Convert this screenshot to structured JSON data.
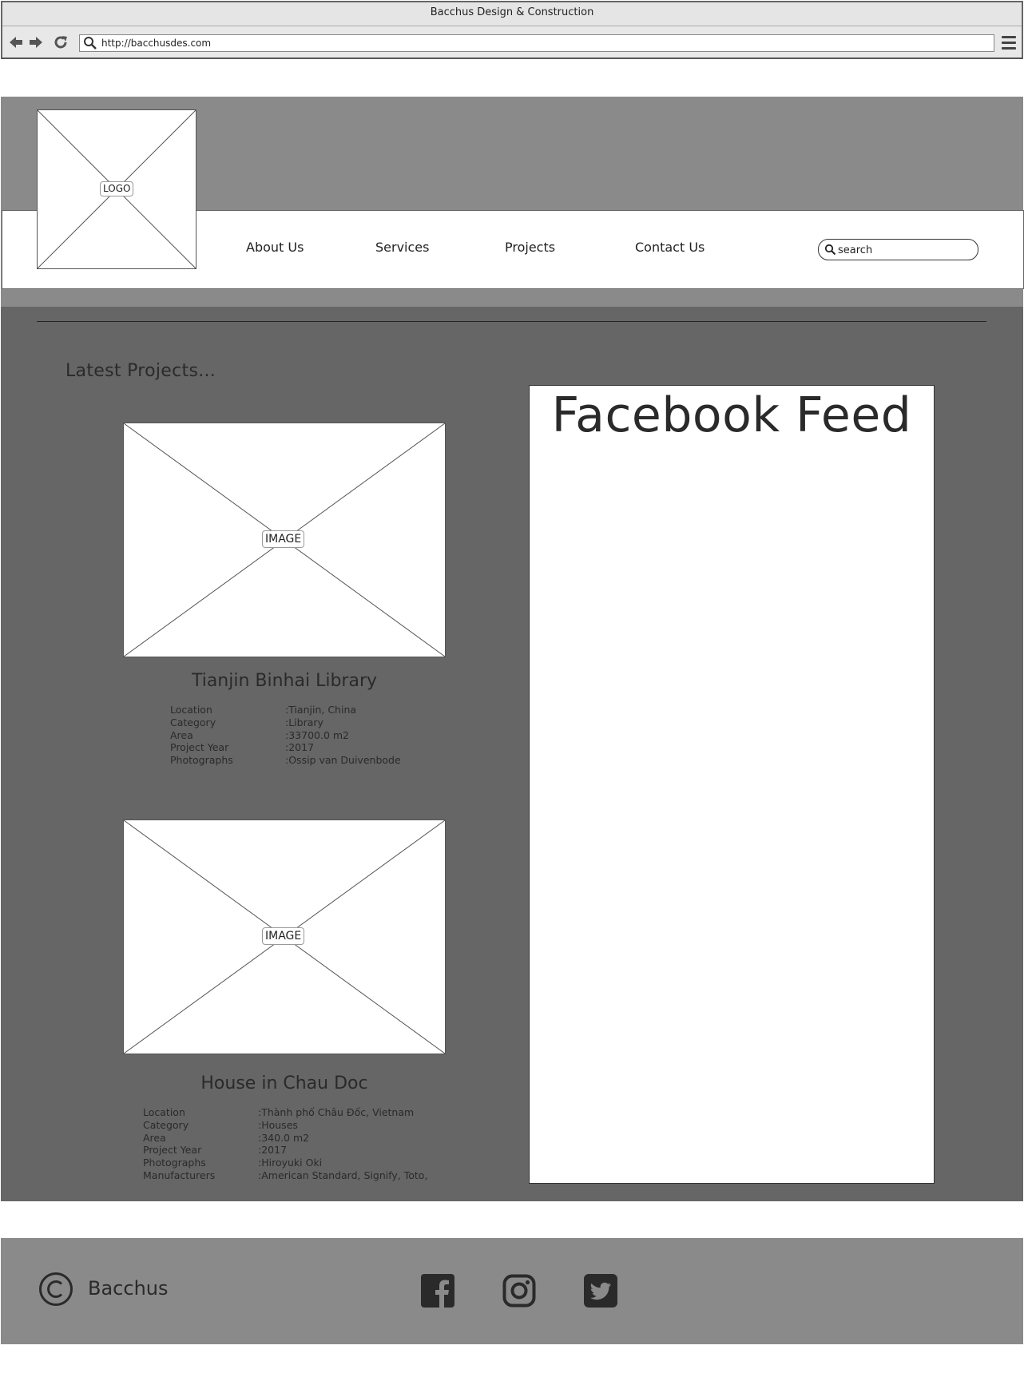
{
  "browser": {
    "window_title": "Bacchus Design & Construction",
    "url": "http://bacchusdes.com"
  },
  "header": {
    "logo_label": "LOGO",
    "nav": [
      "About Us",
      "Services",
      "Projects",
      "Contact Us"
    ],
    "search_placeholder": "search"
  },
  "main": {
    "latest_title": "Latest Projects...",
    "image_label": "IMAGE",
    "projects": [
      {
        "title": "Tianjin Binhai Library",
        "specs": [
          {
            "k": "Location",
            "v": ":Tianjin, China"
          },
          {
            "k": "Category",
            "v": ":Library"
          },
          {
            "k": "Area",
            "v": ":33700.0 m2"
          },
          {
            "k": "Project Year",
            "v": ":2017"
          },
          {
            "k": "Photographs",
            "v": ":Ossip van Duivenbode"
          }
        ]
      },
      {
        "title": "House in Chau Doc",
        "specs": [
          {
            "k": "Location",
            "v": ":Thành phố Châu Đốc, Vietnam"
          },
          {
            "k": "Category",
            "v": ":Houses"
          },
          {
            "k": "Area",
            "v": ":340.0 m2"
          },
          {
            "k": "Project Year",
            "v": ":2017"
          },
          {
            "k": "Photographs",
            "v": ":Hiroyuki Oki"
          },
          {
            "k": "Manufacturers",
            "v": ":American Standard, Signify, Toto,"
          }
        ]
      }
    ],
    "facebook_title": "Facebook Feed"
  },
  "footer": {
    "brand": "Bacchus",
    "social_icons": [
      "facebook-icon",
      "instagram-icon",
      "twitter-icon"
    ]
  }
}
